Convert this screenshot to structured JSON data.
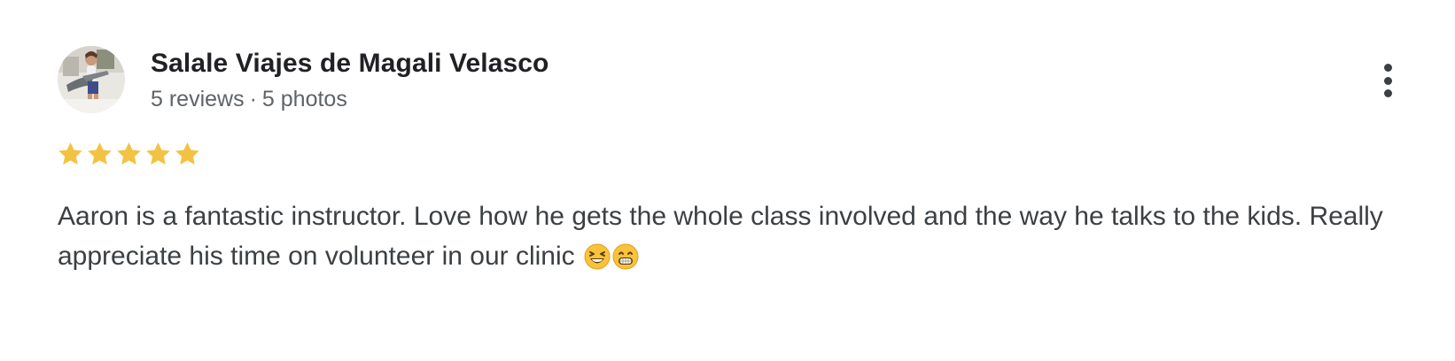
{
  "review": {
    "reviewer": {
      "name": "Salale Viajes de Magali Velasco",
      "reviews_count": "5 reviews",
      "separator": "·",
      "photos_count": "5 photos",
      "avatar_icon": "profile-photo"
    },
    "rating": {
      "value": 5,
      "max": 5,
      "star_color": "#f4c243"
    },
    "text": "Aaron is a fantastic instructor. Love how he gets the whole class involved and the way he talks to the kids. Really appreciate his time on volunteer in our clinic",
    "emojis": [
      "laughing-face-emoji",
      "grinning-face-emoji"
    ],
    "actions": {
      "more_icon": "more-vertical-icon"
    }
  }
}
